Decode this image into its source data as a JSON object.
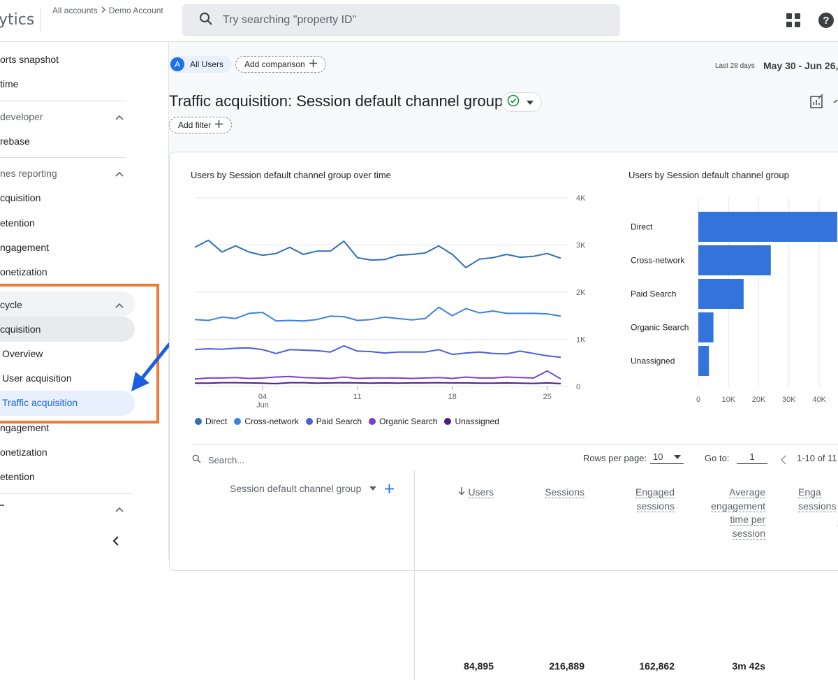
{
  "app": {
    "logo_text": "ytics"
  },
  "breadcrumb": {
    "level1": "All accounts",
    "level2": "Demo Account"
  },
  "search": {
    "placeholder": "Try searching \"property ID\""
  },
  "sidebar": {
    "items": [
      {
        "label": "orts snapshot"
      },
      {
        "label": "time"
      },
      {
        "label": "developer"
      },
      {
        "label": "rebase"
      },
      {
        "label": "nes reporting"
      },
      {
        "label": "cquisition"
      },
      {
        "label": "etention"
      },
      {
        "label": "ngagement"
      },
      {
        "label": "onetization"
      },
      {
        "label": "cycle"
      },
      {
        "label": "cquisition"
      },
      {
        "label": "Overview"
      },
      {
        "label": "User acquisition"
      },
      {
        "label": "Traffic acquisition"
      },
      {
        "label": "ngagement"
      },
      {
        "label": "onetization"
      },
      {
        "label": "etention"
      }
    ]
  },
  "comparison": {
    "segment_badge": "A",
    "segment_label": "All Users",
    "add_comparison": "Add comparison"
  },
  "date_range": {
    "preset": "Last 28 days",
    "range": "May 30 - Jun 26,"
  },
  "report": {
    "title": "Traffic acquisition: Session default channel group",
    "add_filter": "Add filter"
  },
  "colors": {
    "accent": "#1a73e8",
    "highlight_box": "#ef7b3a",
    "arrow": "#1a5fe0",
    "bar": "#3273dc"
  },
  "chart_data": [
    {
      "type": "line",
      "title": "Users by Session default channel group over time",
      "x": [
        "May 30",
        "May 31",
        "Jun 1",
        "Jun 2",
        "Jun 3",
        "Jun 4",
        "Jun 5",
        "Jun 6",
        "Jun 7",
        "Jun 8",
        "Jun 9",
        "Jun 10",
        "Jun 11",
        "Jun 12",
        "Jun 13",
        "Jun 14",
        "Jun 15",
        "Jun 16",
        "Jun 17",
        "Jun 18",
        "Jun 19",
        "Jun 20",
        "Jun 21",
        "Jun 22",
        "Jun 23",
        "Jun 24",
        "Jun 25",
        "Jun 26"
      ],
      "x_tick_labels": [
        {
          "label": "04",
          "sub": "Jun",
          "index": 5
        },
        {
          "label": "11",
          "index": 12
        },
        {
          "label": "18",
          "index": 19
        },
        {
          "label": "25",
          "index": 26
        }
      ],
      "yticks": [
        "4K",
        "3K",
        "2K",
        "1K",
        "0"
      ],
      "ylim": [
        0,
        4000
      ],
      "grid": true,
      "series": [
        {
          "name": "Direct",
          "color": "#2e6fb5",
          "values": [
            2950,
            3100,
            2850,
            2980,
            2850,
            2780,
            2820,
            2950,
            2800,
            2870,
            2870,
            3080,
            2730,
            2680,
            2690,
            2780,
            2800,
            2830,
            2980,
            2800,
            2520,
            2700,
            2730,
            2800,
            2740,
            2760,
            2820,
            2720
          ]
        },
        {
          "name": "Cross-network",
          "color": "#3b82e0",
          "values": [
            1420,
            1400,
            1470,
            1440,
            1550,
            1570,
            1390,
            1400,
            1390,
            1420,
            1490,
            1480,
            1400,
            1420,
            1470,
            1440,
            1410,
            1440,
            1680,
            1500,
            1650,
            1560,
            1600,
            1550,
            1550,
            1550,
            1540,
            1490
          ]
        },
        {
          "name": "Paid Search",
          "color": "#4a5ee0",
          "values": [
            780,
            800,
            790,
            810,
            820,
            780,
            700,
            780,
            770,
            760,
            730,
            860,
            750,
            740,
            710,
            730,
            730,
            730,
            780,
            680,
            710,
            730,
            700,
            690,
            750,
            700,
            650,
            620
          ]
        },
        {
          "name": "Organic Search",
          "color": "#7b3fcf",
          "values": [
            160,
            180,
            180,
            190,
            170,
            180,
            200,
            210,
            190,
            180,
            170,
            200,
            170,
            180,
            180,
            180,
            170,
            180,
            190,
            170,
            200,
            180,
            180,
            200,
            190,
            180,
            330,
            160
          ]
        },
        {
          "name": "Unassigned",
          "color": "#4e1a8a",
          "values": [
            70,
            70,
            80,
            80,
            75,
            70,
            60,
            80,
            80,
            70,
            75,
            80,
            75,
            70,
            75,
            70,
            75,
            75,
            80,
            75,
            75,
            70,
            70,
            75,
            70,
            65,
            75,
            60
          ]
        }
      ]
    },
    {
      "type": "bar",
      "orientation": "horizontal",
      "title": "Users by Session default channel group",
      "categories": [
        "Direct",
        "Cross-network",
        "Paid Search",
        "Organic Search",
        "Unassigned"
      ],
      "values": [
        46000,
        24000,
        15000,
        5000,
        3500
      ],
      "xticks": [
        "0",
        "10K",
        "20K",
        "30K",
        "40K"
      ],
      "xlim": [
        0,
        40000
      ],
      "grid": true
    }
  ],
  "table": {
    "search_placeholder": "Search...",
    "rows_per_page_label": "Rows per page:",
    "rows_per_page_value": "10",
    "goto_label": "Go to:",
    "goto_value": "1",
    "pagination": "1-10 of 11",
    "dimension_header": "Session default channel group",
    "columns": [
      {
        "label": "Users",
        "sorted": "desc"
      },
      {
        "label": "Sessions"
      },
      {
        "label_lines": [
          "Engaged",
          "sessions"
        ]
      },
      {
        "label_lines": [
          "Average",
          "engagement",
          "time per",
          "session"
        ]
      },
      {
        "label_lines": [
          "Enga",
          "sessions",
          "u"
        ]
      }
    ],
    "totals": [
      "84,895",
      "216,889",
      "162,862",
      "3m 42s"
    ]
  }
}
